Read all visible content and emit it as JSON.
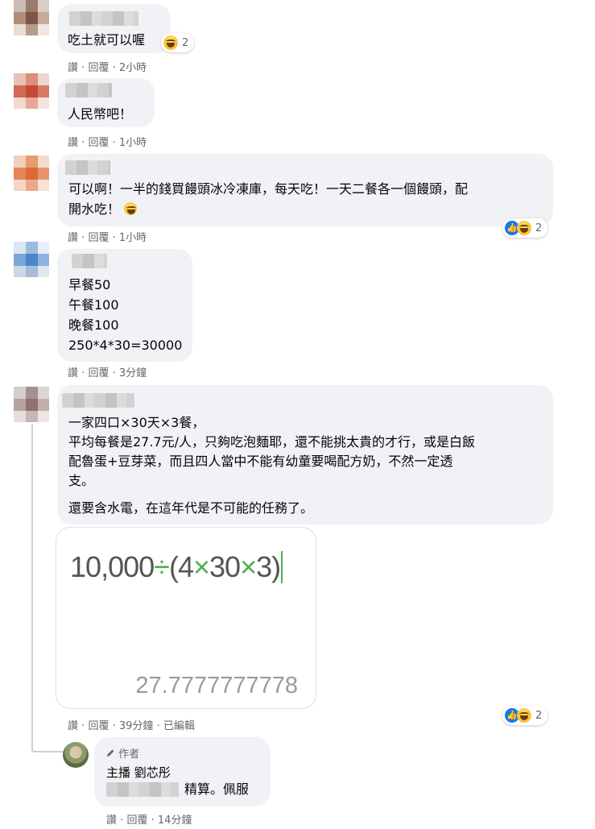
{
  "comments": [
    {
      "text": "吃土就可以喔",
      "reactions": "2",
      "actions": {
        "like": "讚",
        "reply": "回覆",
        "time": "2小時"
      }
    },
    {
      "text": "人民幣吧！",
      "actions": {
        "like": "讚",
        "reply": "回覆",
        "time": "1小時"
      }
    },
    {
      "lines": [
        "可以啊！一半的錢買饅頭冰冷凍庫，每天吃！一天二餐各一個饅頭，配",
        "開水吃！"
      ],
      "reactions": "2",
      "actions": {
        "like": "讚",
        "reply": "回覆",
        "time": "1小時"
      }
    },
    {
      "lines": [
        "早餐50",
        "午餐100",
        "晚餐100",
        "250*4*30=30000"
      ],
      "actions": {
        "like": "讚",
        "reply": "回覆",
        "time": "3分鐘"
      }
    },
    {
      "lines": [
        "一家四口×30天×3餐，",
        "平均每餐是27.7元/人，只夠吃泡麵耶，還不能挑太貴的才行，或是白飯",
        "配魯蛋+豆芽菜，而且四人當中不能有幼童要喝配方奶，不然一定透",
        "支。",
        "還要含水電，在這年代是不可能的任務了。"
      ],
      "calculator": {
        "expression": "10,000÷(4×30×3)",
        "result": "27.7777777778"
      },
      "reactions": "2",
      "actions": {
        "like": "讚",
        "reply": "回覆",
        "time": "39分鐘",
        "edited": "已編輯"
      }
    }
  ],
  "reply": {
    "badge": "作者",
    "author": "主播 劉芯彤",
    "text": "精算。佩服",
    "actions": {
      "like": "讚",
      "reply": "回覆",
      "time": "14分鐘"
    }
  },
  "dot": "·",
  "colors": {
    "bubble": "#f0f2f5",
    "meta": "#65676b",
    "like": "#1877f2",
    "operator": "#4caf50"
  }
}
